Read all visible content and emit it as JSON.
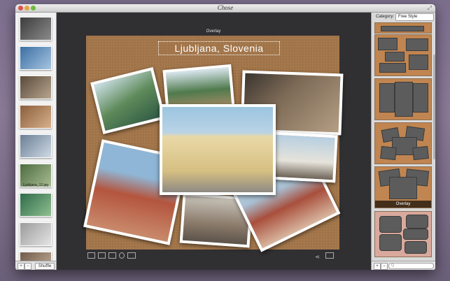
{
  "window": {
    "title": "Chose"
  },
  "sidebar": {
    "thumbnails": [
      {
        "name": "street-1",
        "colors": [
          "#3d3d3d",
          "#8a8a8a"
        ]
      },
      {
        "name": "city-view",
        "colors": [
          "#3b6fa3",
          "#a6c4e0"
        ]
      },
      {
        "name": "street-2",
        "colors": [
          "#5a4a3a",
          "#b7a58f"
        ]
      },
      {
        "name": "buildings",
        "colors": [
          "#8a5e3c",
          "#d7b08b"
        ]
      },
      {
        "name": "church",
        "colors": [
          "#6a7f95",
          "#cfd9e4"
        ]
      },
      {
        "name": "castle",
        "colors": [
          "#4d6b3f",
          "#a9bd93"
        ]
      },
      {
        "name": "river",
        "colors": [
          "#2f6b4a",
          "#8fbf8f"
        ]
      },
      {
        "name": "facade",
        "colors": [
          "#9a9a9a",
          "#e5e5e5"
        ]
      },
      {
        "name": "rooftops",
        "colors": [
          "#6f5a4a",
          "#c9b49e"
        ]
      }
    ],
    "selected_caption": "Ljubljana_12.jpg",
    "add_label": "+",
    "remove_label": "−",
    "shuffle_label": "Shuffle"
  },
  "canvas": {
    "overlay_label": "Overlay",
    "collage_title": "Ljubljana, Slovenia"
  },
  "right_panel": {
    "category_label": "Category:",
    "category_value": "Free Style",
    "template_overlay_label": "Overlay",
    "add_label": "+",
    "remove_label": "−",
    "search_placeholder": "Q"
  }
}
